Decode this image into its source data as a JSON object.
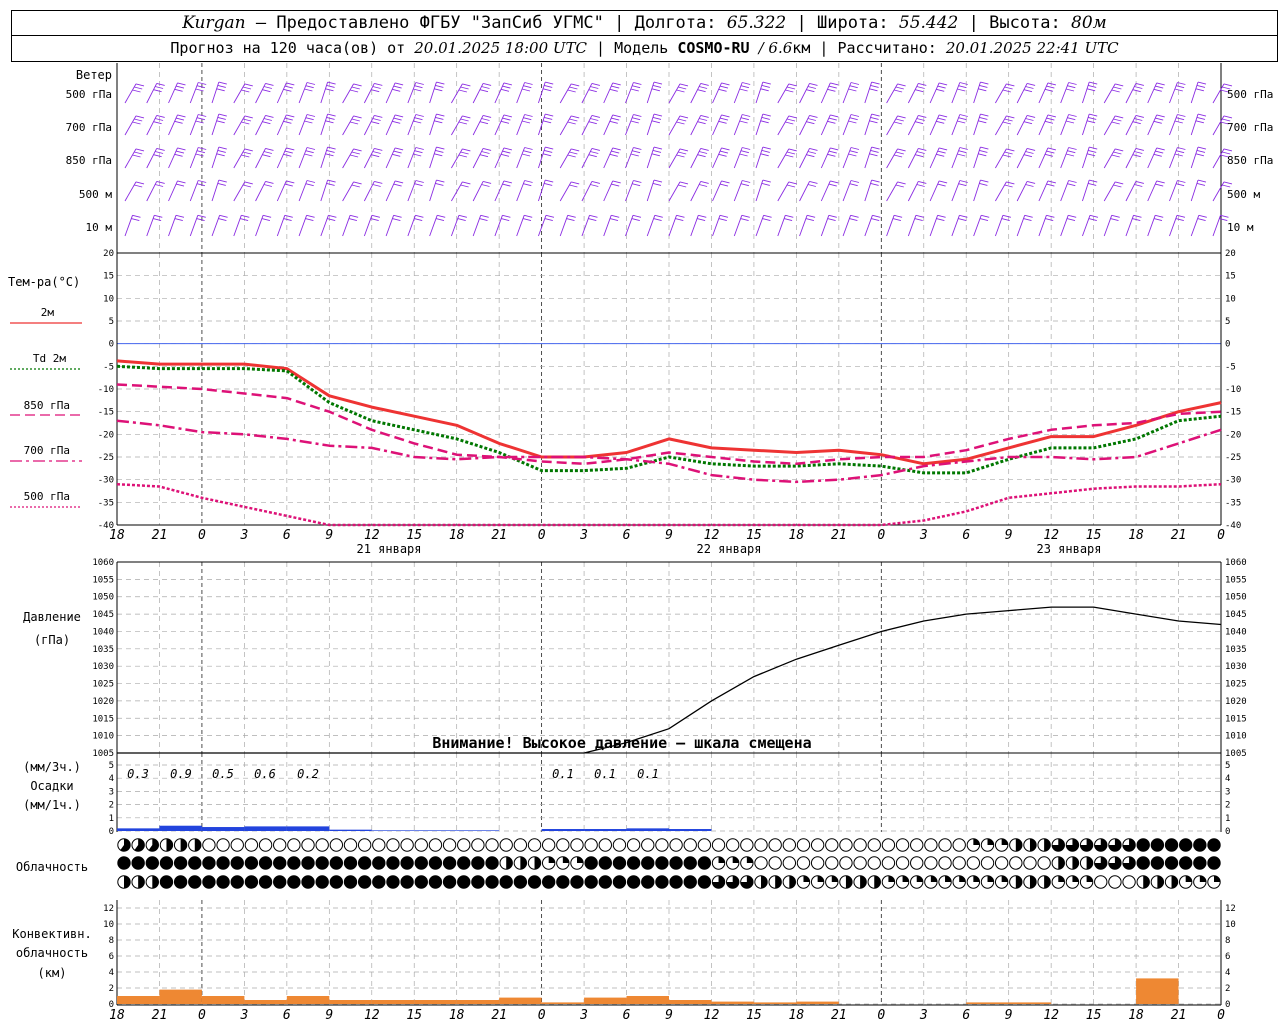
{
  "header": {
    "city": "Kurgan",
    "dash": "–",
    "provider": "Предоставлено ФГБУ \"ЗапСиб УГМС\"",
    "sep": "|",
    "lon_label": "Долгота:",
    "lon_value": "65.322",
    "lat_label": "Широта:",
    "lat_value": "55.442",
    "alt_label": "Высота:",
    "alt_value": "80м",
    "forecast_prefix": "Прогноз на 120 часа(ов) от",
    "forecast_from": "20.01.2025 18:00 UTC",
    "model_label": "Модель",
    "model_name": "COSMO-RU",
    "model_res_num": "/ 6.6",
    "model_res_unit": "км",
    "calc_label": "Рассчитано:",
    "calc_time": "20.01.2025 22:41 UTC"
  },
  "wind_panel": {
    "title": "Ветер",
    "levels": [
      "500 гПа",
      "700 гПа",
      "850 гПа",
      "500 м",
      "10 м"
    ],
    "barb_color": "#8a2be2"
  },
  "time_axis": {
    "hour_labels": [
      "18",
      "21",
      "0",
      "3",
      "6",
      "9",
      "12",
      "15",
      "18",
      "21",
      "0",
      "3",
      "6",
      "9",
      "12",
      "15",
      "18",
      "21",
      "0",
      "3",
      "6",
      "9",
      "12",
      "15",
      "18",
      "21",
      "0"
    ],
    "days": [
      "21 января",
      "22 января",
      "23 января"
    ]
  },
  "temperature_panel": {
    "title": "Тем-ра(°C)",
    "legend": [
      {
        "label": "2м",
        "color": "#ee3333",
        "style": "solid"
      },
      {
        "label": "Td 2м",
        "color": "#007700",
        "style": "dotted"
      },
      {
        "label": "850 гПа",
        "color": "#dd1177",
        "style": "dashed"
      },
      {
        "label": "700 гПа",
        "color": "#dd1177",
        "style": "dashdot"
      },
      {
        "label": "500 гПа",
        "color": "#dd1177",
        "style": "dotted"
      }
    ],
    "y_ticks": [
      "20",
      "15",
      "10",
      "5",
      "0",
      "-5",
      "-10",
      "-15",
      "-20",
      "-25",
      "-30",
      "-35",
      "-40"
    ]
  },
  "pressure_panel": {
    "title_line1": "Давление",
    "title_line2": "(гПа)",
    "y_ticks": [
      "1060",
      "1055",
      "1050",
      "1045",
      "1040",
      "1035",
      "1030",
      "1025",
      "1020",
      "1015",
      "1010",
      "1005"
    ],
    "warning": "Внимание! Высокое давление – шкала смещена"
  },
  "precip_panel": {
    "title_line1": "(мм/3ч.)",
    "title_line2": "Осадки",
    "title_line3": "(мм/1ч.)",
    "y_ticks": [
      "5",
      "4",
      "3",
      "2",
      "1",
      "0"
    ],
    "totals": [
      "0.3",
      "0.9",
      "0.5",
      "0.6",
      "0.2",
      "0.1",
      "0.1",
      "0.1"
    ],
    "bar_color": "#2244dd"
  },
  "cloud_panel": {
    "title": "Облачность"
  },
  "convective_panel": {
    "title_line1": "Конвективн.",
    "title_line2": "облачность",
    "title_line3": "(км)",
    "y_ticks": [
      "12",
      "10",
      "8",
      "6",
      "4",
      "2",
      "0"
    ],
    "bar_color": "#ee8833"
  },
  "chart_data": {
    "type": "line",
    "time_hours_utc": [
      18,
      21,
      0,
      3,
      6,
      9,
      12,
      15,
      18,
      21,
      0,
      3,
      6,
      9,
      12,
      15,
      18,
      21,
      0,
      3,
      6,
      9,
      12,
      15,
      18,
      21,
      0
    ],
    "temperature": {
      "ylim": [
        -40,
        20
      ],
      "series": [
        {
          "name": "2м",
          "values": [
            -3.8,
            -4.5,
            -4.5,
            -4.5,
            -5.5,
            -11.5,
            -14,
            -16,
            -18,
            -22,
            -25,
            -25,
            -24,
            -21,
            -23,
            -23.5,
            -24,
            -23.5,
            -24.5,
            -26.5,
            -25.5,
            -23,
            -20.5,
            -20.5,
            -18,
            -15,
            -13
          ]
        },
        {
          "name": "Td 2м",
          "values": [
            -5,
            -5.5,
            -5.5,
            -5.5,
            -6,
            -13,
            -17,
            -19,
            -21,
            -24,
            -28,
            -28,
            -27.5,
            -25,
            -26.5,
            -27,
            -27,
            -26.5,
            -27,
            -28.5,
            -28.5,
            -25.5,
            -23,
            -23,
            -21,
            -17,
            -16
          ]
        },
        {
          "name": "850 гПа",
          "values": [
            -9,
            -9.5,
            -10,
            -11,
            -12,
            -15,
            -19,
            -22,
            -24.5,
            -25,
            -26,
            -26.5,
            -25.5,
            -24,
            -25,
            -26,
            -26.5,
            -25.5,
            -25,
            -25,
            -23.5,
            -21,
            -19,
            -18,
            -17.5,
            -15.5,
            -15
          ]
        },
        {
          "name": "700 гПа",
          "values": [
            -17,
            -18,
            -19.5,
            -20,
            -21,
            -22.5,
            -23,
            -25,
            -25.5,
            -25,
            -25,
            -25,
            -25.5,
            -26.5,
            -29,
            -30,
            -30.5,
            -30,
            -29,
            -27,
            -26,
            -25,
            -25,
            -25.5,
            -25,
            -22,
            -19
          ]
        },
        {
          "name": "500 гПа",
          "values": [
            -31,
            -31.5,
            -34,
            -36,
            -38,
            -40.5,
            -42,
            -43,
            -43,
            -43,
            -43,
            -43,
            -43,
            -43,
            -43,
            -42,
            -40,
            -40,
            -40,
            -39,
            -37,
            -34,
            -33,
            -32,
            -31.5,
            -31.5,
            -31
          ]
        }
      ]
    },
    "pressure": {
      "ylim": [
        1005,
        1060
      ],
      "values": [
        1002,
        1003,
        1004,
        1004,
        1003,
        1002,
        1001,
        1000,
        1000,
        1000,
        1001,
        1004,
        1008,
        1012,
        1020,
        1027,
        1032,
        1036,
        1040,
        1043,
        1045,
        1046,
        1047,
        1047,
        1045,
        1043,
        1042
      ]
    },
    "precipitation": {
      "ylim": [
        0,
        5
      ],
      "values": [
        0.2,
        0.4,
        0.3,
        0.35,
        0.35,
        0.1,
        0.05,
        0.05,
        0.05,
        0,
        0.15,
        0.15,
        0.2,
        0.15,
        0,
        0,
        0,
        0,
        0,
        0,
        0,
        0,
        0,
        0,
        0,
        0,
        0
      ]
    },
    "cloud_cover": {
      "upper": [
        0.6,
        0.5,
        0,
        0,
        0,
        0,
        0,
        0,
        0,
        0,
        0,
        0,
        0,
        0,
        0,
        0,
        0,
        0,
        0,
        0,
        0.25,
        0.5,
        0.75,
        0.75,
        1,
        1,
        1
      ],
      "middle": [
        1,
        1,
        1,
        1,
        1,
        1,
        1,
        1,
        1,
        0.5,
        0.25,
        1,
        1,
        1,
        0.25,
        0,
        0,
        0,
        0,
        0,
        0,
        0,
        0.5,
        0.75,
        1,
        1,
        1
      ],
      "lower": [
        0.5,
        1,
        1,
        1,
        1,
        1,
        1,
        1,
        1,
        1,
        1,
        1,
        1,
        1,
        0.75,
        0.5,
        0.25,
        0.5,
        0.25,
        0.25,
        0.25,
        0.5,
        0.25,
        0,
        0.5,
        0.25,
        0
      ]
    },
    "convective_cloud": {
      "ylim": [
        0,
        12
      ],
      "values": [
        1,
        1.8,
        1,
        0.5,
        1,
        0.5,
        0.5,
        0.5,
        0.5,
        0.8,
        0.2,
        0.8,
        1,
        0.5,
        0.3,
        0.2,
        0.3,
        0,
        0,
        0,
        0.2,
        0.2,
        0,
        0,
        3.2,
        0,
        0
      ]
    }
  }
}
